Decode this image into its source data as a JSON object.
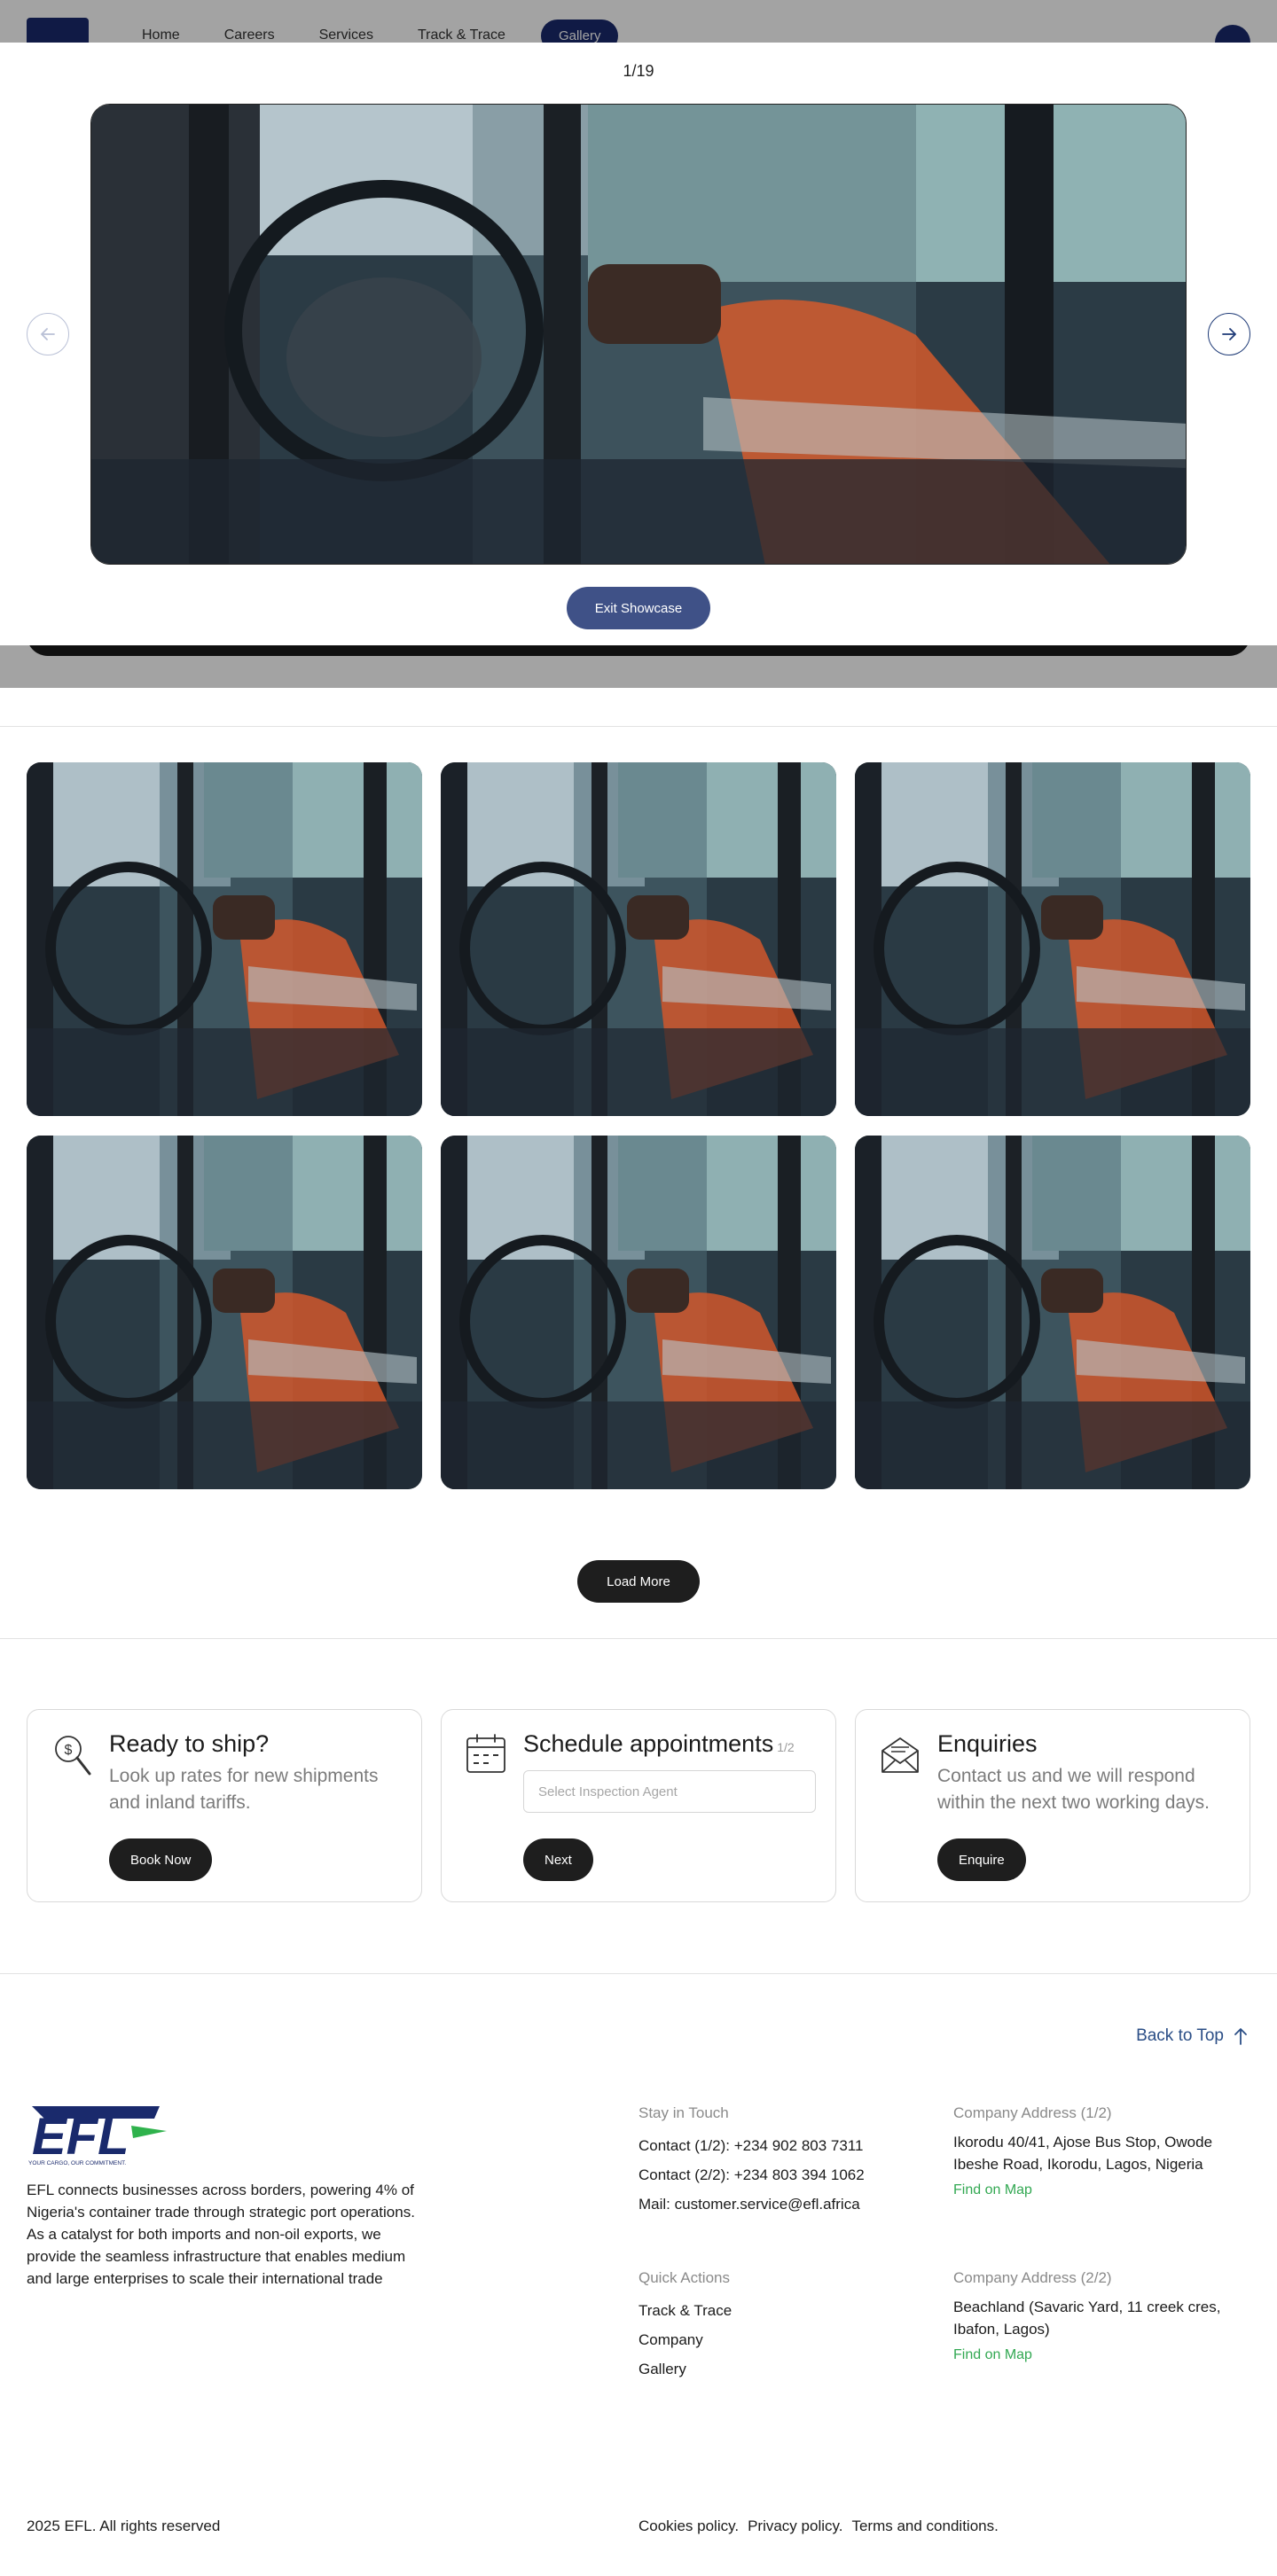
{
  "background": {
    "nav": [
      "Home",
      "Careers",
      "Services",
      "Track & Trace"
    ],
    "cta": "Gallery"
  },
  "showcase": {
    "counter": "1/19",
    "exit_label": "Exit Showcase"
  },
  "gallery": {
    "load_more_label": "Load More"
  },
  "cards": {
    "ship": {
      "title": "Ready to ship?",
      "text": "Look up rates for new shipments and inland tariffs.",
      "button": "Book Now"
    },
    "schedule": {
      "title": "Schedule appointments",
      "step": "1/2",
      "placeholder": "Select Inspection Agent",
      "button": "Next"
    },
    "enquiries": {
      "title": "Enquiries",
      "text": "Contact us and we will respond within the next two working days.",
      "button": "Enquire"
    }
  },
  "footer": {
    "back_to_top": "Back to Top",
    "logo_text": "EFL",
    "tagline": "YOUR CARGO, OUR COMMITMENT.",
    "description": "EFL connects businesses across borders, powering 4% of Nigeria's container trade through strategic port operations. As a catalyst for both imports and non-oil exports, we provide the seamless infrastructure that enables medium and large enterprises to scale their international trade",
    "stay_in_touch": {
      "heading": "Stay in Touch",
      "contact1": "Contact (1/2): +234 902 803 7311",
      "contact2": "Contact (2/2): +234 803 394 1062",
      "mail": "Mail: customer.service@efl.africa"
    },
    "address1": {
      "heading": "Company Address (1/2)",
      "text": "Ikorodu 40/41, Ajose Bus Stop, Owode Ibeshe Road, Ikorodu, Lagos, Nigeria",
      "map": "Find on Map"
    },
    "quick_actions": {
      "heading": "Quick Actions",
      "items": [
        "Track & Trace",
        "Company",
        "Gallery"
      ]
    },
    "address2": {
      "heading": "Company Address (2/2)",
      "text": "Beachland (Savaric Yard, 11 creek cres, Ibafon, Lagos)",
      "map": "Find on Map"
    },
    "copyright": "2025 EFL. All rights reserved",
    "policies": [
      "Cookies policy.",
      "Privacy policy.",
      "Terms and conditions."
    ]
  },
  "colors": {
    "brand_navy": "#1a2a6c",
    "exit_button": "#3f5187",
    "link_blue": "#2b4e86",
    "map_green": "#32a852",
    "dark_button": "#1e1e1e"
  }
}
